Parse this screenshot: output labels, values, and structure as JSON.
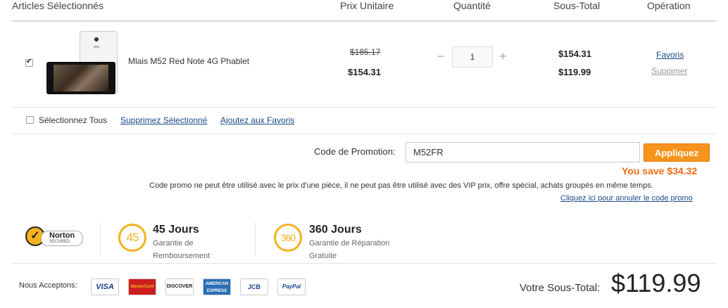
{
  "header": {
    "items_col": "Articles Sélectionnés",
    "unit_price_col": "Prix Unitaire",
    "quantity_col": "Quantité",
    "subtotal_col": "Sous-Total",
    "operation_col": "Opération"
  },
  "item": {
    "checked": true,
    "name": "Mlais M52 Red Note 4G Phablet",
    "original_price": "$185.17",
    "unit_price": "$154.31",
    "quantity_minus": "−",
    "quantity": "1",
    "quantity_plus": "+",
    "subtotal_original": "$154.31",
    "subtotal": "$119.99",
    "favorites_link": "Favoris",
    "delete_link": "Suppimer"
  },
  "bulk": {
    "select_all": "Sélectionnez Tous",
    "delete_selected": "Supprimez Sélectionné",
    "add_favorites": "Ajoutez aux Favoris"
  },
  "promo": {
    "label": "Code de Promotion:",
    "code": "M52FR",
    "apply_button": "Appliquez",
    "savings": "You save $34.32",
    "note": "Code promo ne peut être utilisé avec le prix d'une pièce, il ne peut pas être utilisé avec des VIP prix, offre spécial, achats groupés en même temps.",
    "cancel_link": "Cliquez ici pour annuler le code promo"
  },
  "trust": {
    "norton_title": "Norton",
    "norton_sub": "SECURED",
    "refund_badge": "45",
    "refund_title": "45 Jours",
    "refund_line1": "Garantie de",
    "refund_line2": "Remboursement",
    "repair_badge": "360",
    "repair_title": "360 Jours",
    "repair_line1": "Garantie de Réparation",
    "repair_line2": "Gratuite"
  },
  "footer": {
    "accept_label": "Nous Acceptons:",
    "cards": [
      "VISA",
      "MasterCard",
      "DISCOVER",
      "AMERICAN EXPRESS",
      "JCB",
      "PayPal"
    ],
    "subtotal_label": "Votre Sous-Total:",
    "subtotal_value": "$119.99"
  },
  "colors": {
    "accent": "#f7941d",
    "savings": "#ee6b14",
    "link": "#1a4a8a",
    "badge": "#f5b21f"
  }
}
